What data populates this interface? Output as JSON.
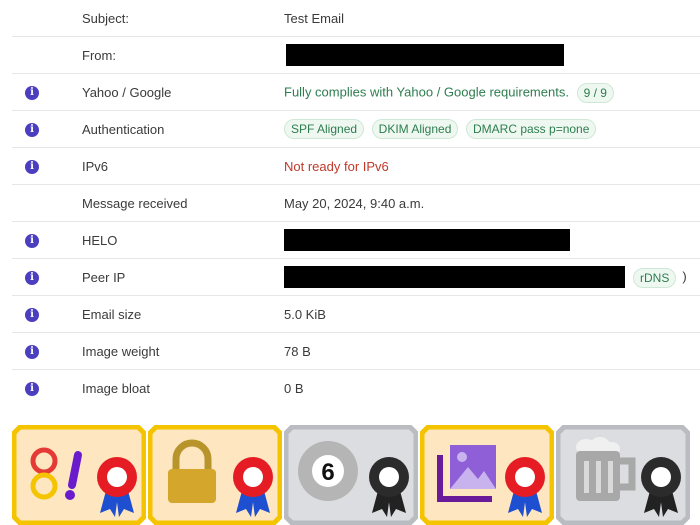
{
  "rows": [
    {
      "label": "Subject:",
      "value": "Test Email",
      "info": false
    },
    {
      "label": "From:",
      "value": "",
      "info": false
    },
    {
      "label": "Yahoo / Google",
      "value": "Fully complies with Yahoo / Google requirements.",
      "score": "9 / 9",
      "info": true
    },
    {
      "label": "Authentication",
      "badges": [
        "SPF Aligned",
        "DKIM Aligned",
        "DMARC pass p=none"
      ],
      "info": true
    },
    {
      "label": "IPv6",
      "value": "Not ready for IPv6",
      "info": true
    },
    {
      "label": "Message received",
      "value": "May 20, 2024, 9:40 a.m.",
      "info": false
    },
    {
      "label": "HELO",
      "value": "",
      "info": true
    },
    {
      "label": "Peer IP",
      "value": "",
      "rdns": "rDNS",
      "rdns_close": ")",
      "info": true
    },
    {
      "label": "Email size",
      "value": "5.0 KiB",
      "info": true
    },
    {
      "label": "Image weight",
      "value": "78 B",
      "info": true
    },
    {
      "label": "Image bloat",
      "value": "0 B",
      "info": true
    }
  ],
  "info_icon_glyph": "i",
  "colors": {
    "info_icon": "#4b3fbf",
    "ok_text": "#2e7d4f",
    "error_text": "#c0392b",
    "badge_bg": "#eef8f1",
    "cert_gold_border": "#f5c400",
    "cert_gold_bg": "#fde6c0",
    "cert_grey_border": "#b9bcc0",
    "cert_grey_bg": "#dcdde0"
  },
  "certificates": [
    {
      "name": "yahoo-google-certificate",
      "icon": "yahoo-google-logo-icon",
      "ribbon": "red-ribbon-icon",
      "tier": "gold"
    },
    {
      "name": "authentication-certificate",
      "icon": "padlock-icon",
      "ribbon": "red-ribbon-icon",
      "tier": "gold"
    },
    {
      "name": "ipv6-certificate",
      "icon": "eight-ball-icon",
      "glyph": "6",
      "ribbon": "black-ribbon-icon",
      "tier": "grey"
    },
    {
      "name": "image-certificate",
      "icon": "image-icon",
      "ribbon": "red-ribbon-icon",
      "tier": "gold"
    },
    {
      "name": "size-certificate",
      "icon": "beer-mug-icon",
      "ribbon": "black-ribbon-icon",
      "tier": "grey"
    }
  ]
}
